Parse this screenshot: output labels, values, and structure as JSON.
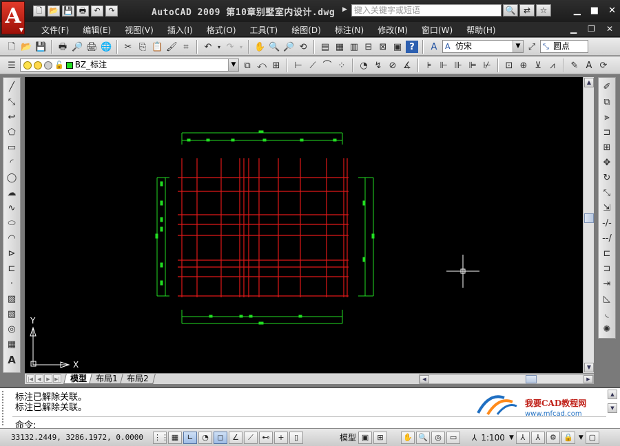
{
  "window": {
    "title": "AutoCAD  2009  第10章别墅室内设计.dwg",
    "search_placeholder": "键入关键字或短语"
  },
  "menu": [
    "文件(F)",
    "编辑(E)",
    "视图(V)",
    "插入(I)",
    "格式(O)",
    "工具(T)",
    "绘图(D)",
    "标注(N)",
    "修改(M)",
    "窗口(W)",
    "帮助(H)"
  ],
  "toolbar1": {
    "text_style": "仿宋",
    "dim_style": "圆点"
  },
  "toolbar2": {
    "layer": "BZ_标注"
  },
  "ucs": {
    "y_label": "Y",
    "x_label": "X"
  },
  "tabs": [
    "模型",
    "布局1",
    "布局2"
  ],
  "command": {
    "history": [
      "标注已解除关联。",
      "标注已解除关联。"
    ],
    "prompt": "命令:"
  },
  "watermark": {
    "brand": "我要CAD教程网",
    "url": "www.mfcad.com"
  },
  "status": {
    "coords": "33132.2449,  3286.1972,  0.0000",
    "space": "模型",
    "scale": "1:100"
  },
  "colors": {
    "drawing_red": "#e01818",
    "drawing_green": "#22dd22",
    "canvas": "#000000"
  }
}
